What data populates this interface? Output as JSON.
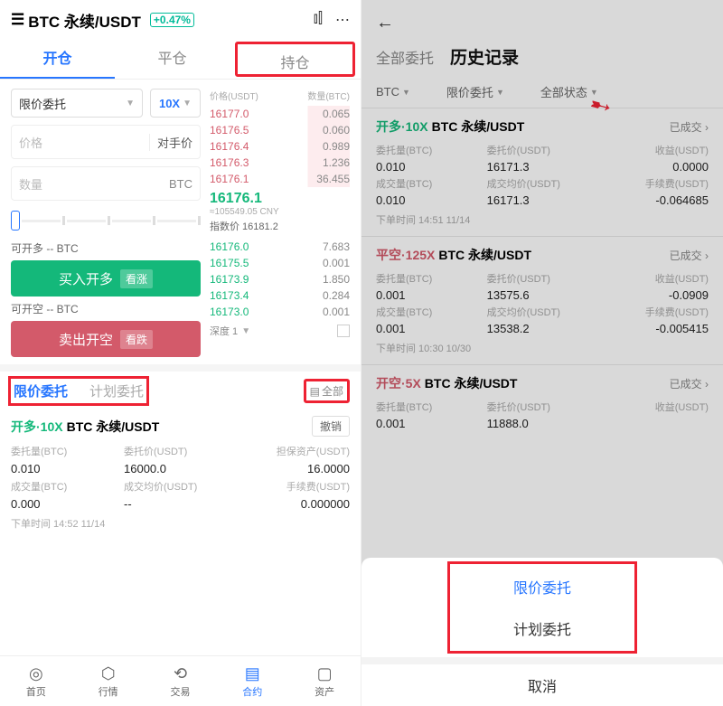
{
  "left": {
    "header": {
      "title": "BTC 永续/USDT",
      "change": "+0.47%"
    },
    "tabs": [
      "开仓",
      "平仓",
      "持仓"
    ],
    "orderType": "限价委托",
    "leverage": "10X",
    "priceInput": {
      "placeholder": "价格",
      "btn": "对手价"
    },
    "qtyInput": {
      "placeholder": "数量",
      "unit": "BTC"
    },
    "availLong": "可开多 -- BTC",
    "btnBuy": {
      "label": "买入开多",
      "tag": "看涨"
    },
    "availShort": "可开空 -- BTC",
    "btnSell": {
      "label": "卖出开空",
      "tag": "看跌"
    },
    "obHead": {
      "price": "价格(USDT)",
      "qty": "数量(BTC)"
    },
    "asks": [
      {
        "p": "16177.0",
        "q": "0.065"
      },
      {
        "p": "16176.5",
        "q": "0.060"
      },
      {
        "p": "16176.4",
        "q": "0.989"
      },
      {
        "p": "16176.3",
        "q": "1.236"
      },
      {
        "p": "16176.1",
        "q": "36.455"
      }
    ],
    "last": "16176.1",
    "lastSub": "≈105549.05 CNY",
    "idx": "指数价 16181.2",
    "bids": [
      {
        "p": "16176.0",
        "q": "7.683"
      },
      {
        "p": "16175.5",
        "q": "0.001"
      },
      {
        "p": "16173.9",
        "q": "1.850"
      },
      {
        "p": "16173.4",
        "q": "0.284"
      },
      {
        "p": "16173.0",
        "q": "0.001"
      }
    ],
    "depth": "深度 1",
    "orderTabs": [
      "限价委托",
      "计划委托"
    ],
    "allBtn": "全部",
    "order": {
      "side": "开多",
      "lev": "·10X",
      "pair": "BTC 永续/USDT",
      "cancel": "撤销",
      "labels": {
        "qty": "委托量(BTC)",
        "price": "委托价(USDT)",
        "margin": "担保资产(USDT)",
        "filled": "成交量(BTC)",
        "avg": "成交均价(USDT)",
        "fee": "手续费(USDT)"
      },
      "vals": {
        "qty": "0.010",
        "price": "16000.0",
        "margin": "16.0000",
        "filled": "0.000",
        "avg": "--",
        "fee": "0.000000"
      },
      "time": "下单时间 14:52 11/14"
    },
    "nav": [
      "首页",
      "行情",
      "交易",
      "合约",
      "资产"
    ]
  },
  "right": {
    "tabs": [
      "全部委托",
      "历史记录"
    ],
    "filters": [
      "BTC",
      "限价委托",
      "全部状态"
    ],
    "records": [
      {
        "side": "开多",
        "sideClass": "s-long",
        "lev": "·10X",
        "pair": "BTC 永续/USDT",
        "status": "已成交",
        "l": {
          "a": "委托量(BTC)",
          "b": "委托价(USDT)",
          "c": "收益(USDT)",
          "d": "成交量(BTC)",
          "e": "成交均价(USDT)",
          "f": "手续费(USDT)"
        },
        "v": {
          "a": "0.010",
          "b": "16171.3",
          "c": "0.0000",
          "d": "0.010",
          "e": "16171.3",
          "f": "-0.064685"
        },
        "time": "下单时间 14:51 11/14"
      },
      {
        "side": "平空",
        "sideClass": "s-short",
        "lev": "·125X",
        "pair": "BTC 永续/USDT",
        "status": "已成交",
        "l": {
          "a": "委托量(BTC)",
          "b": "委托价(USDT)",
          "c": "收益(USDT)",
          "d": "成交量(BTC)",
          "e": "成交均价(USDT)",
          "f": "手续费(USDT)"
        },
        "v": {
          "a": "0.001",
          "b": "13575.6",
          "c": "-0.0909",
          "d": "0.001",
          "e": "13538.2",
          "f": "-0.005415"
        },
        "time": "下单时间 10:30 10/30"
      },
      {
        "side": "开空",
        "sideClass": "s-short",
        "lev": "·5X",
        "pair": "BTC 永续/USDT",
        "status": "已成交",
        "l": {
          "a": "委托量(BTC)",
          "b": "委托价(USDT)",
          "c": "收益(USDT)"
        },
        "v": {
          "a": "0.001",
          "b": "11888.0",
          "c": ""
        },
        "time": ""
      }
    ],
    "sheet": {
      "opt1": "限价委托",
      "opt2": "计划委托",
      "cancel": "取消"
    }
  }
}
